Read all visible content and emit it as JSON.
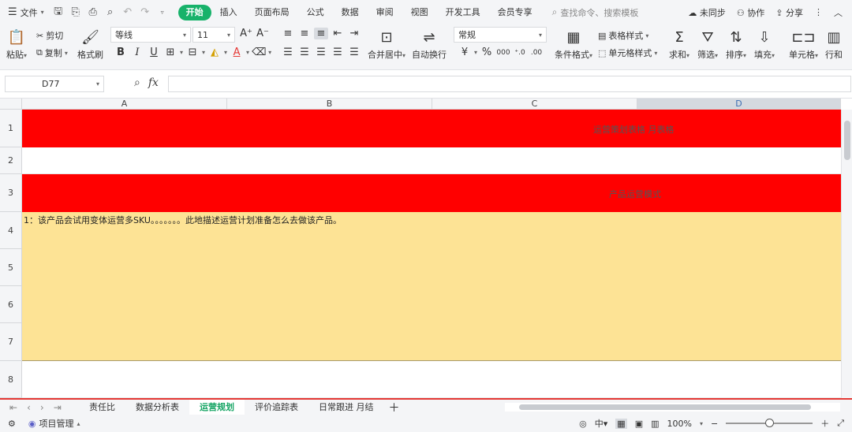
{
  "menu": {
    "file": "文件",
    "tabs": [
      "开始",
      "插入",
      "页面布局",
      "公式",
      "数据",
      "审阅",
      "视图",
      "开发工具",
      "会员专享"
    ],
    "search_placeholder": "查找命令、搜索模板",
    "sync": "未同步",
    "collab": "协作",
    "share": "分享"
  },
  "ribbon": {
    "paste": "粘贴",
    "cut": "剪切",
    "copy": "复制",
    "format_painter": "格式刷",
    "font_name": "等线",
    "font_size": "11",
    "merge_center": "合并居中",
    "wrap_text": "自动换行",
    "number_format": "常规",
    "table_style": "表格样式",
    "cond_format": "条件格式",
    "cell_style": "单元格样式",
    "sum": "求和",
    "filter": "筛选",
    "sort": "排序",
    "fill": "填充",
    "cell": "单元格",
    "row_col": "行和"
  },
  "formula_bar": {
    "cell_ref": "D77",
    "fx": "fx",
    "formula": ""
  },
  "grid": {
    "columns": [
      "A",
      "B",
      "C",
      "D"
    ],
    "rows": [
      "1",
      "2",
      "3",
      "4",
      "5",
      "6",
      "7",
      "8"
    ],
    "title": "运营策划表格 月表格",
    "section_title": "产品运营模式",
    "body_text": "1：该产品会试用变体运营多SKU。。。。。。。此地描述运营计划准备怎么去做该产品。"
  },
  "sheets": {
    "tabs": [
      "责任比",
      "数据分析表",
      "运营规划",
      "评价追踪表",
      "日常跟进 月结"
    ],
    "active_index": 2
  },
  "status": {
    "project": "项目管理",
    "zoom": "100%"
  },
  "colors": {
    "red_band": "#ff0000",
    "yellow_band": "#fde395",
    "accent": "#17b26a"
  }
}
